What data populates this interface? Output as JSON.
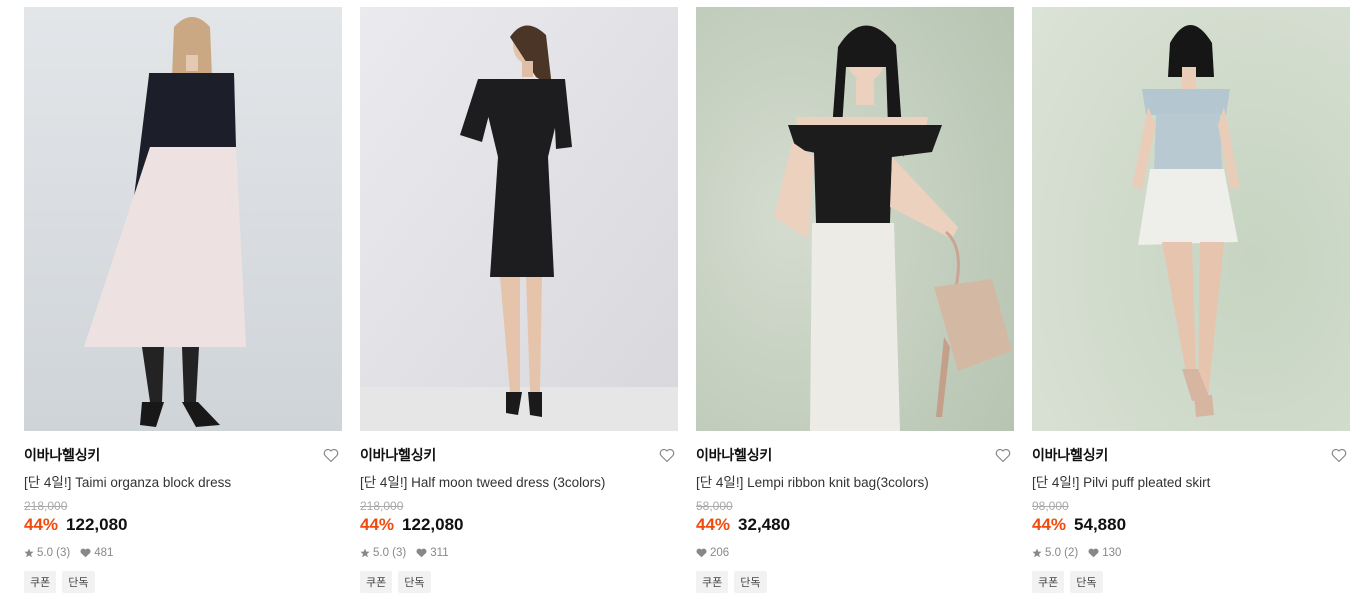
{
  "products": [
    {
      "brand": "이바나헬싱키",
      "name": "[단 4일!] Taimi organza block dress",
      "original_price": "218,000",
      "discount": "44%",
      "price": "122,080",
      "rating": "5.0 (3)",
      "likes": "481",
      "tags": [
        "쿠폰",
        "단독"
      ],
      "photo_colors": {
        "bg": "#dfe3e6",
        "top": "#1c1f29",
        "bottom": "#ede2e1"
      }
    },
    {
      "brand": "이바나헬싱키",
      "name": "[단 4일!] Half moon tweed dress (3colors)",
      "original_price": "218,000",
      "discount": "44%",
      "price": "122,080",
      "rating": "5.0 (3)",
      "likes": "311",
      "tags": [
        "쿠폰",
        "단독"
      ],
      "photo_colors": {
        "bg": "#e9e9ed",
        "top": "#1d1d1f",
        "bottom": "#1d1d1f"
      }
    },
    {
      "brand": "이바나헬싱키",
      "name": "[단 4일!] Lempi ribbon knit bag(3colors)",
      "original_price": "58,000",
      "discount": "44%",
      "price": "32,480",
      "rating": "",
      "likes": "206",
      "tags": [
        "쿠폰",
        "단독"
      ],
      "photo_colors": {
        "bg": "#c7d3c3",
        "top": "#1c1c1c",
        "bottom": "#ecebe5"
      }
    },
    {
      "brand": "이바나헬싱키",
      "name": "[단 4일!] Pilvi puff pleated skirt",
      "original_price": "98,000",
      "discount": "44%",
      "price": "54,880",
      "rating": "5.0 (2)",
      "likes": "130",
      "tags": [
        "쿠폰",
        "단독"
      ],
      "photo_colors": {
        "bg": "#ced8ca",
        "top": "#b4c6cf",
        "bottom": "#eeeeea"
      }
    }
  ]
}
